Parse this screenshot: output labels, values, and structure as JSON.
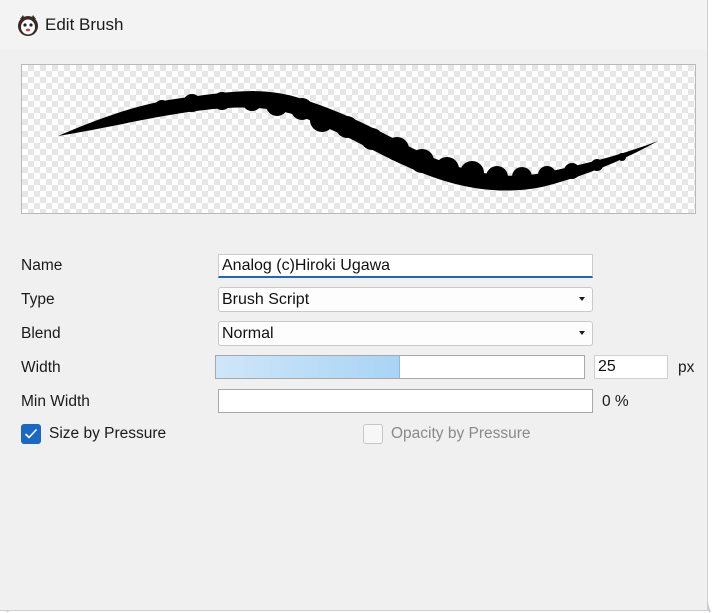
{
  "window": {
    "title": "Edit Brush",
    "icon": "app-mascot-icon"
  },
  "form": {
    "name_label": "Name",
    "name_value": "Analog (c)Hiroki Ugawa",
    "type_label": "Type",
    "type_value": "Brush Script",
    "blend_label": "Blend",
    "blend_value": "Normal",
    "width_label": "Width",
    "width_value": "25",
    "width_unit": "px",
    "width_fraction": 0.5,
    "min_width_label": "Min Width",
    "min_width_value": "0 %",
    "min_width_fraction": 0,
    "size_by_pressure_label": "Size by Pressure",
    "size_by_pressure_checked": true,
    "opacity_by_pressure_label": "Opacity by Pressure",
    "opacity_by_pressure_checked": false,
    "opacity_by_pressure_enabled": false
  },
  "colors": {
    "accent": "#1a67c4",
    "slider_fill": "#a8d4f5",
    "stroke": "#000000"
  }
}
